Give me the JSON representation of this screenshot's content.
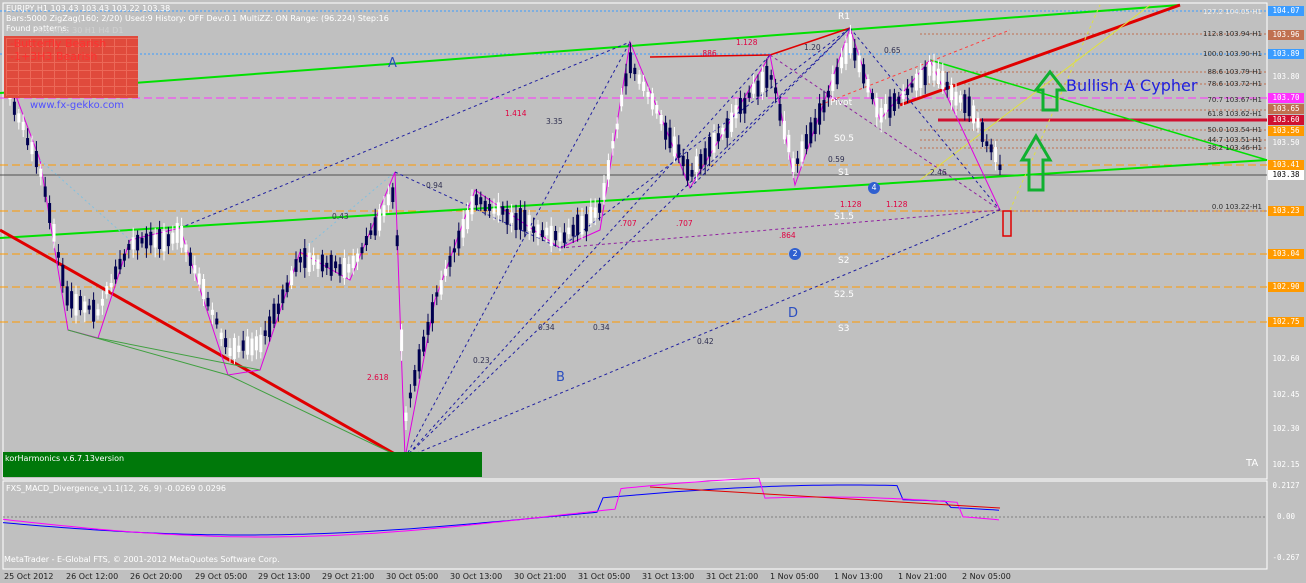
{
  "header": {
    "symbol_line": "EURJPY,H1  103.43 103.43 103.22 103.38",
    "settings_line": "Bars:5000  ZigZag(160; 2/20)  Used:9  History: OFF Dev:0.1  MultiZZ: ON  Range: (96.224)  Step:16",
    "found_patterns": "Found patterns:",
    "timeframes": "M5 M15 30 H1 H4 D1",
    "pattern_1": "-Butterfly Bearish",
    "pattern_2": "-1+3H3 Bearish"
  },
  "watermark": "www.fx-gekko.com",
  "indicator_version": "korHarmonics v.6.7.13version",
  "macd_title": "FXS_MACD_Divergence_v1.1(12, 26, 9) -0.0269 0.0296",
  "copyright": "MetaTrader - E-Global FTS, © 2001-2012 MetaQuotes Software Corp.",
  "bullish_label": "Bullish A Cypher",
  "point_labels": {
    "a": "A",
    "b": "B",
    "d": "D"
  },
  "pivot_labels": {
    "r1": "R1",
    "pivot": "Pivot",
    "s05": "S0.5",
    "s1": "S1",
    "s15": "S1.5",
    "s2": "S2",
    "s25": "S2.5",
    "s3": "S3"
  },
  "ratio_labels": {
    "r1414": "1.414",
    "r335": "3.35",
    "r094": "0.94",
    "r043": "0.43",
    "r2618": "2.618",
    "r023": "0.23",
    "r034a": "0.34",
    "r034b": "0.34",
    "r042": "0.42",
    "r0707a": ".707",
    "r0707b": ".707",
    "r0864": ".864",
    "r1128a": "1.128",
    "r1128b": "1.128",
    "r1128c": "1.128",
    "r0886": ".886",
    "r120": "1.20",
    "r059": "0.59",
    "r246": "2.46",
    "r065": "0.65"
  },
  "fib_labels": {
    "f1": "112.8 103.94-H1",
    "f2": "100.0 103.90-H1",
    "f3": "88.6 103.79-H1",
    "f4": "78.6 103.72-H1",
    "f5": "70.7 103.67-H1",
    "f6": "61.8 103.62-H1",
    "f7": "50.0 103.54-H1",
    "f8": "44.7 103.51-H1",
    "f9": "38.2 103.46-H1",
    "f10": "0.0 103.22-H1",
    "ftop": "127.2 104.05-H1"
  },
  "price_axis": {
    "p1": "104.07",
    "p2": "103.96",
    "p3": "103.89",
    "p4": "103.70",
    "p5": "103.65",
    "p6": "103.60",
    "p7": "103.56",
    "p8": "103.41",
    "p9": "103.38",
    "p10": "103.23",
    "p11": "103.04",
    "p12": "102.90",
    "p13": "102.75",
    "p14": "102.60",
    "p15": "102.45",
    "p16": "102.30",
    "p17": "102.15",
    "p18": "103.80",
    "p19": "103.50"
  },
  "macd_axis": {
    "top": "0.2127",
    "mid": "0.00",
    "bottom": "-0.267"
  },
  "time_axis": [
    "25 Oct 2012",
    "26 Oct 12:00",
    "26 Oct 20:00",
    "29 Oct 05:00",
    "29 Oct 13:00",
    "29 Oct 21:00",
    "30 Oct 05:00",
    "30 Oct 13:00",
    "30 Oct 21:00",
    "31 Oct 05:00",
    "31 Oct 13:00",
    "31 Oct 21:00",
    "1 Nov 05:00",
    "1 Nov 13:00",
    "1 Nov 21:00",
    "2 Nov 05:00"
  ],
  "colors": {
    "background": "#c0c0c0",
    "bull_candle": "#ffffff",
    "bear_candle": "#000050",
    "trend_green": "#00e000",
    "trend_red": "#e00000",
    "harmonic_magenta": "#e000e0",
    "harmonic_blue": "#2020a0",
    "pivot_orange": "#ff9a00",
    "macd_blue": "#0000ff",
    "macd_magenta": "#ff00ff"
  },
  "legend_badges": {
    "b2": "2",
    "b4": "4"
  },
  "logo": "TA"
}
